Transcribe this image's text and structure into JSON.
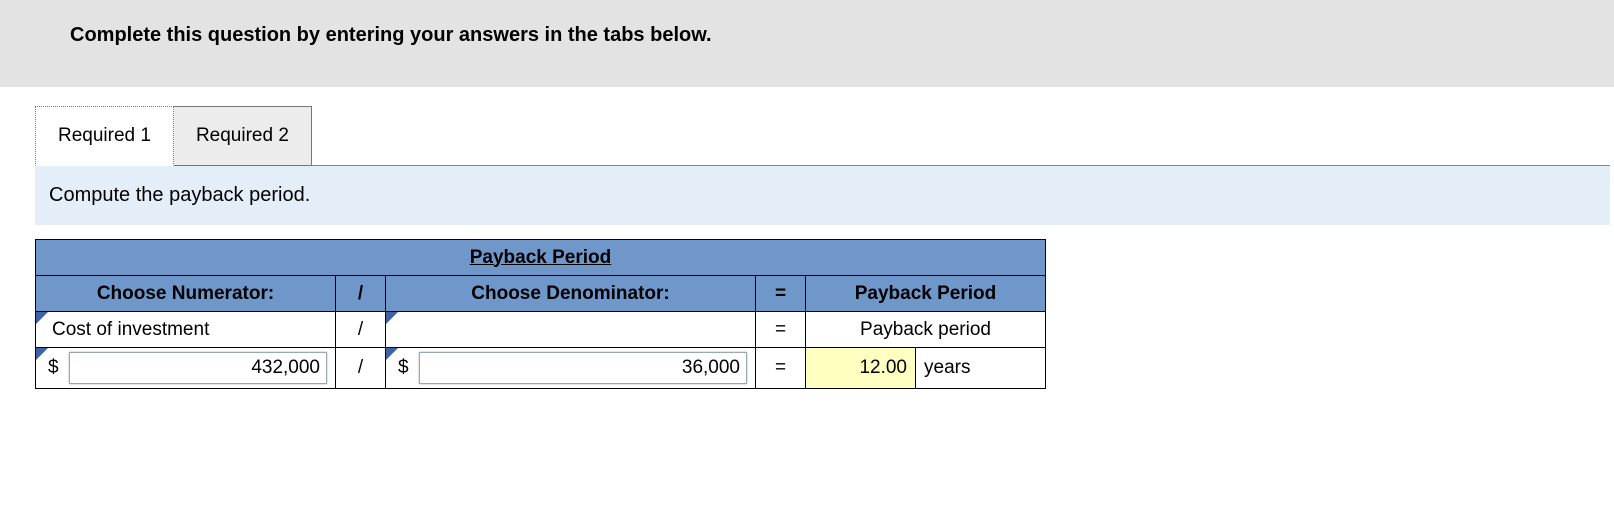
{
  "instruction": "Complete this question by entering your answers in the tabs below.",
  "tabs": {
    "t1": "Required 1",
    "t2": "Required 2"
  },
  "question": "Compute the payback period.",
  "table": {
    "title": "Payback Period",
    "numHdr": "Choose Numerator:",
    "divHdr": "/",
    "denHdr": "Choose Denominator:",
    "eqHdr": "=",
    "resHdr": "Payback Period",
    "numSel": "Cost of investment",
    "div2": "/",
    "denSel": "",
    "eq2": "=",
    "resLabel": "Payback period",
    "cur": "$",
    "numVal": "432,000",
    "div3": "/",
    "denVal": "36,000",
    "eq3": "=",
    "resVal": "12.00",
    "resUnit": "years"
  }
}
